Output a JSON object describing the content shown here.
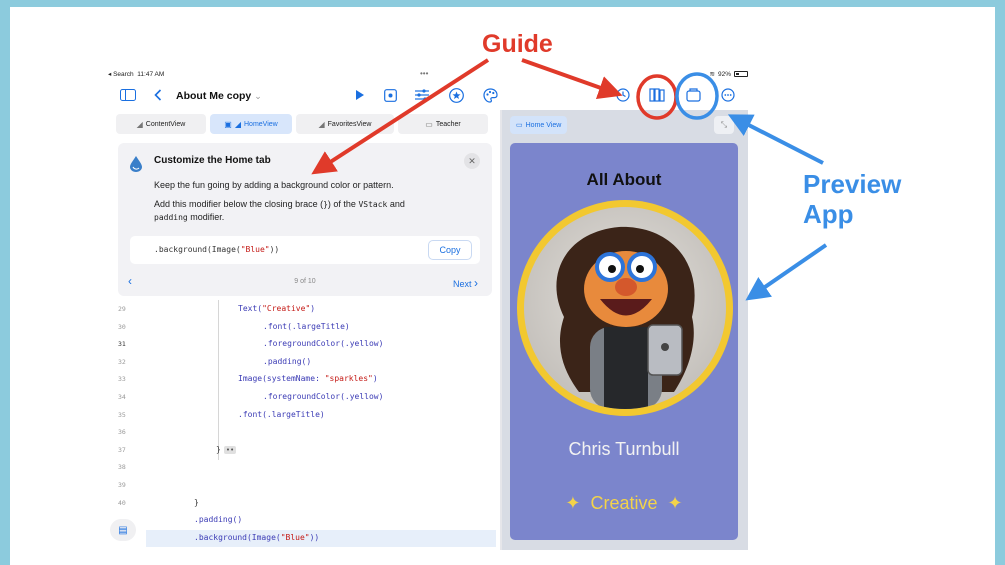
{
  "annotations": {
    "guide": "Guide",
    "preview_line1": "Preview",
    "preview_line2": "App",
    "guide_color": "#e03a2a",
    "preview_color": "#3a8ee6"
  },
  "status_bar": {
    "back_label": "◂ Search",
    "time": "11:47 AM",
    "dots": "•••",
    "battery_text": "92%"
  },
  "toolbar": {
    "project_title": "About Me copy",
    "icons": [
      "sidebar-icon",
      "chevron-left-icon",
      "play-icon",
      "record-icon",
      "sliders-icon",
      "star-icon",
      "palette-icon",
      "history-icon",
      "book-icon",
      "window-icon",
      "more-icon"
    ]
  },
  "tabs": [
    {
      "label": "ContentView",
      "icon": "swift-icon",
      "active": false
    },
    {
      "label": "HomeView",
      "icon": "swift-icon",
      "active": true
    },
    {
      "label": "FavoritesView",
      "icon": "swift-icon",
      "active": false
    },
    {
      "label": "Teacher",
      "icon": "image-icon",
      "active": false
    }
  ],
  "guide": {
    "title": "Customize the Home tab",
    "para1": "Keep the fun going by adding a background color or pattern.",
    "para2_a": "Add this modifier below the closing brace (",
    "para2_brace": "}",
    "para2_b": ") of the ",
    "para2_vstack": "VStack",
    "para2_c": " and ",
    "para2_padding": "padding",
    "para2_d": " modifier.",
    "code_prefix": ".background(Image(",
    "code_string": "\"Blue\"",
    "code_suffix": "))",
    "copy_label": "Copy",
    "step": "9 of 10",
    "next_label": "Next"
  },
  "editor": {
    "lines": [
      {
        "num": "29",
        "code": "Text(",
        "str": "\"Creative\"",
        "tail": ")",
        "indent": 1
      },
      {
        "num": "30",
        "code": ".font(.largeTitle)",
        "indent": 2
      },
      {
        "num": "31",
        "code": ".foregroundColor(.yellow)",
        "indent": 2,
        "current": true
      },
      {
        "num": "32",
        "code": ".padding()",
        "indent": 2
      },
      {
        "num": "33",
        "code": "Image(systemName: ",
        "str": "\"sparkles\"",
        "tail": ")",
        "indent": 1
      },
      {
        "num": "34",
        "code": ".foregroundColor(.yellow)",
        "indent": 2
      },
      {
        "num": "35",
        "code": ".font(.largeTitle)",
        "indent": 1
      },
      {
        "num": "36",
        "code": "",
        "indent": 0
      },
      {
        "num": "37",
        "code": "}",
        "fold": "••",
        "indent": 0
      },
      {
        "num": "38",
        "code": "",
        "indent": 0
      },
      {
        "num": "39",
        "code": "",
        "indent": 0
      },
      {
        "num": "40",
        "code": "}",
        "indent": -1
      },
      {
        "num": "",
        "code": ".padding()",
        "indent": -1
      },
      {
        "num": "",
        "code": ".background(Image(",
        "str": "\"Blue\"",
        "tail": "))",
        "indent": -1
      }
    ]
  },
  "preview": {
    "tab_label": "Home View",
    "app_title": "All About",
    "name": "Chris Turnbull",
    "creative": "Creative",
    "bg_color": "#7b85cc",
    "ring_color": "#f2c830"
  }
}
